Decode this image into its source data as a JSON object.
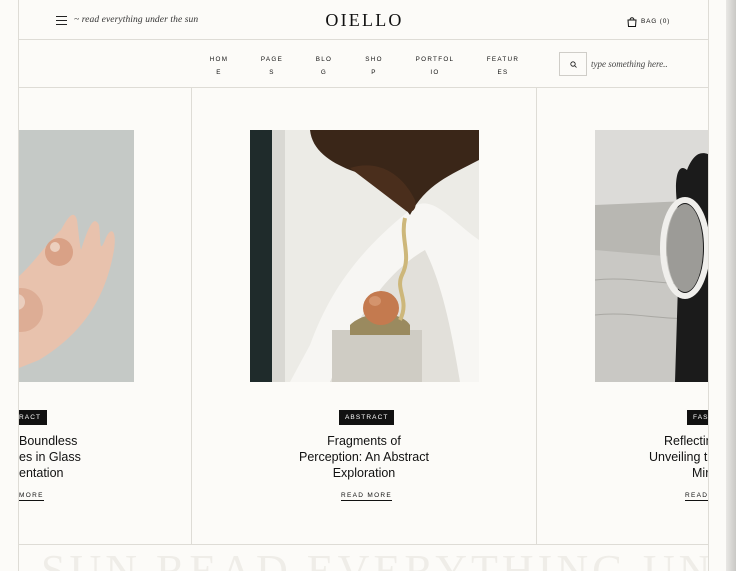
{
  "header": {
    "tagline": "~ read everything under the sun",
    "logo": "OIELLO",
    "bag_label": "BAG (0)",
    "icons": {
      "menu": "hamburger-menu-icon",
      "bag": "shopping-bag-icon",
      "search": "search-icon"
    }
  },
  "nav": {
    "items": [
      {
        "line1": "HOM",
        "line2": "E"
      },
      {
        "line1": "PAGE",
        "line2": "S"
      },
      {
        "line1": "BLO",
        "line2": "G"
      },
      {
        "line1": "SHO",
        "line2": "P"
      },
      {
        "line1": "PORTFOL",
        "line2": "IO"
      },
      {
        "line1": "FEATUR",
        "line2": "ES"
      }
    ],
    "search_placeholder": "type something here.."
  },
  "cards": [
    {
      "badge": "RACT",
      "title_lines": [
        "Boundless",
        "es in Glass",
        "entation"
      ],
      "read_more": "MORE"
    },
    {
      "badge": "ABSTRACT",
      "title_lines": [
        "Fragments of",
        "Perception: An Abstract",
        "Exploration"
      ],
      "read_more": "READ MORE"
    },
    {
      "badge": "FASH",
      "title_lines": [
        "Reflectin",
        "Unveiling t",
        "Mir"
      ],
      "read_more": "READ"
    }
  ],
  "marquee_text": "SUN READ EVERYTHING UNDER",
  "colors": {
    "accent": "#111111",
    "background": "#fcfbf8",
    "border": "#dedcd6"
  }
}
